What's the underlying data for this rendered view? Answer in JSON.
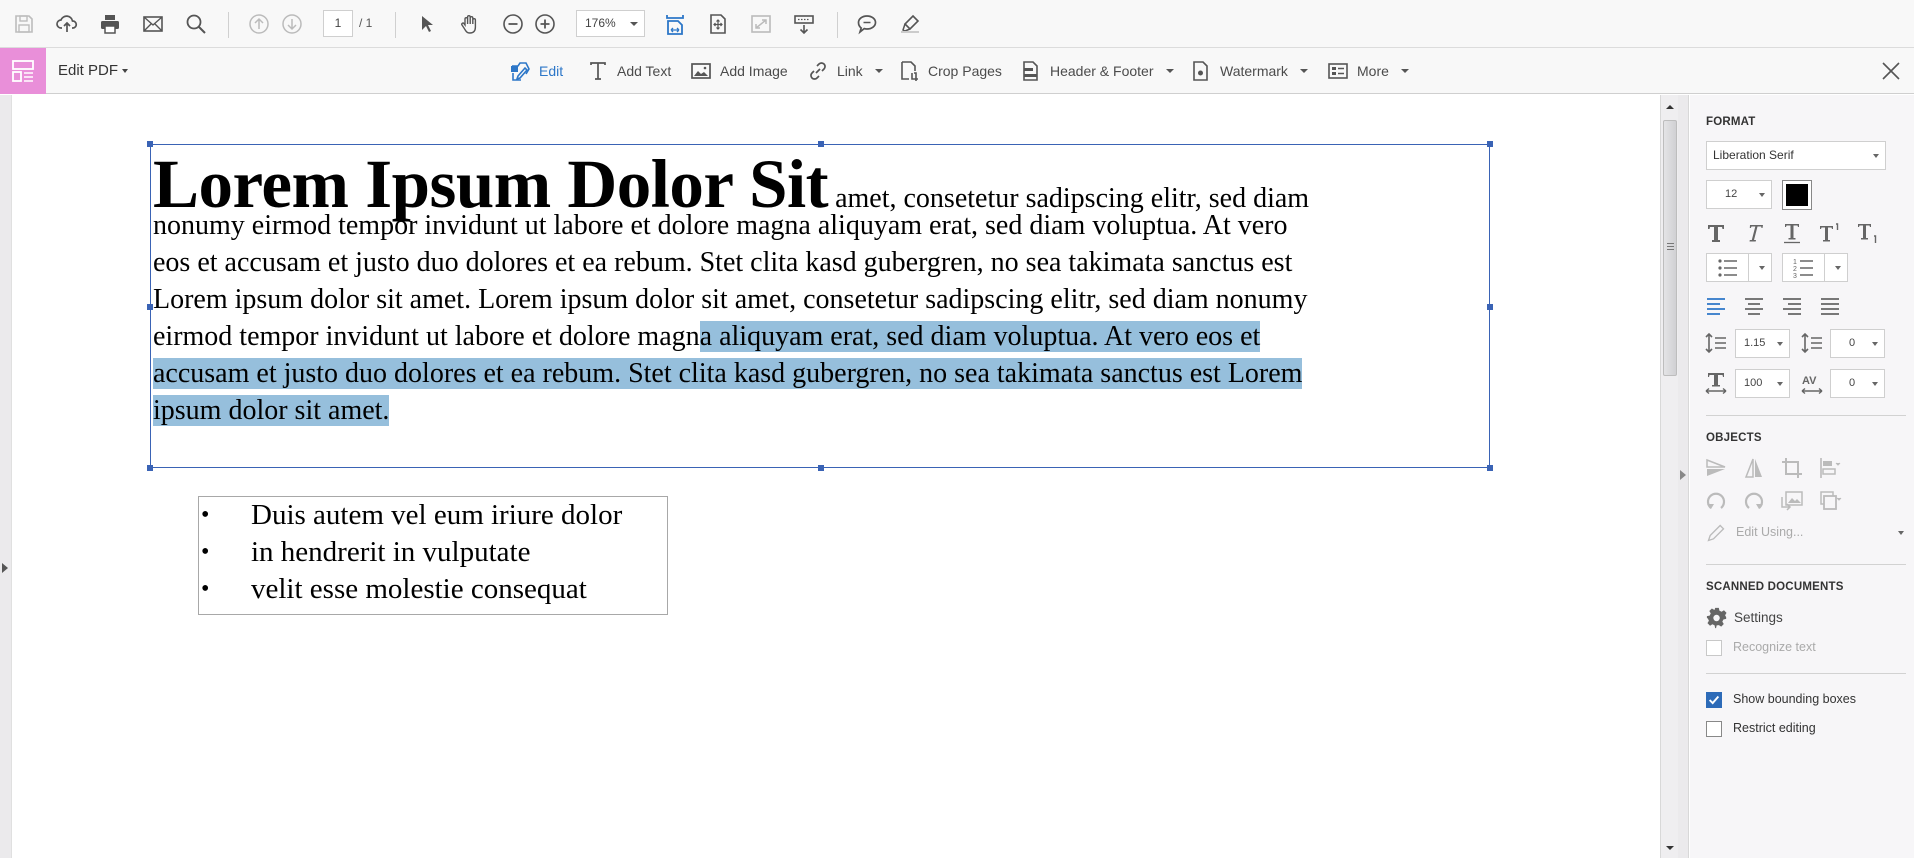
{
  "top_toolbar": {
    "page_current": "1",
    "page_total": "/ 1",
    "zoom_level": "176%",
    "icons": [
      "save-icon",
      "upload-cloud-icon",
      "print-icon",
      "email-icon",
      "search-icon",
      "previous-page-icon",
      "next-page-icon",
      "select-cursor-icon",
      "hand-tool-icon",
      "zoom-out-icon",
      "zoom-in-icon",
      "fit-width-icon",
      "fit-page-icon",
      "full-screen-icon",
      "keyboard-scroll-icon",
      "comment-icon",
      "highlight-icon"
    ]
  },
  "edit_toolbar": {
    "title": "Edit PDF",
    "tools": [
      {
        "label": "Edit",
        "active": true
      },
      {
        "label": "Add Text"
      },
      {
        "label": "Add Image"
      },
      {
        "label": "Link",
        "dropdown": true
      },
      {
        "label": "Crop Pages"
      },
      {
        "label": "Header & Footer",
        "dropdown": true
      },
      {
        "label": "Watermark",
        "dropdown": true
      },
      {
        "label": "More",
        "dropdown": true
      }
    ],
    "accent_color": "#e98fd9",
    "active_color": "#2d77c8"
  },
  "document": {
    "heading": "Lorem Ipsum Dolor Sit",
    "lines": [
      " amet, consetetur sadipscing elitr, sed diam",
      "nonumy eirmod tempor invidunt ut labore et dolore magna aliquyam erat, sed diam voluptua. At vero",
      "eos et accusam et justo duo dolores et ea rebum. Stet clita kasd gubergren, no sea takimata sanctus est",
      "Lorem ipsum dolor sit amet. Lorem ipsum dolor sit amet, consetetur sadipscing elitr, sed diam nonumy"
    ],
    "line5_plain": "eirmod tempor invidunt ut labore et dolore magn",
    "line5_selected": "a aliquyam erat, sed diam voluptua. At vero eos et ",
    "line6_selected": "accusam et justo duo dolores et ea rebum. Stet clita kasd gubergren, no sea takimata sanctus est Lorem ",
    "line7_selected": "ipsum dolor sit amet.",
    "bullets": [
      "Duis autem vel eum iriure dolor",
      "in hendrerit in vulputate",
      "velit esse molestie consequat"
    ],
    "bullet_char": "•",
    "selection_color": "#96bfdc",
    "frame_color": "#3a63b5"
  },
  "right_panel": {
    "format": {
      "title": "FORMAT",
      "font_family": "Liberation Serif",
      "font_size": "12",
      "text_color": "#000000",
      "line_spacing": "1.15",
      "paragraph_spacing": "0",
      "horizontal_scaling": "100",
      "character_spacing": "0",
      "alignment_selected": "left"
    },
    "objects": {
      "title": "OBJECTS",
      "edit_using": "Edit Using..."
    },
    "scanned": {
      "title": "SCANNED DOCUMENTS",
      "settings_label": "Settings",
      "recognize_text_label": "Recognize text",
      "recognize_text_checked": false
    },
    "show_bounding_boxes_label": "Show bounding boxes",
    "show_bounding_boxes_checked": true,
    "restrict_editing_label": "Restrict editing",
    "restrict_editing_checked": false
  }
}
